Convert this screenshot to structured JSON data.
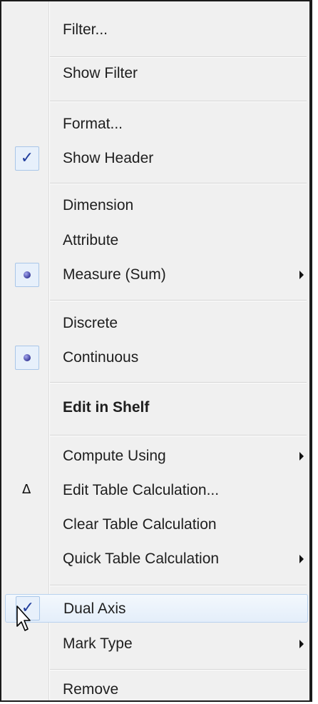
{
  "menu": {
    "items": [
      {
        "label": "Filter...",
        "icon": null
      },
      {
        "label": "Show Filter",
        "icon": null
      },
      {
        "label": "Format...",
        "icon": null
      },
      {
        "label": "Show Header",
        "icon": "checkmark-icon"
      },
      {
        "label": "Dimension",
        "icon": null
      },
      {
        "label": "Attribute",
        "icon": null
      },
      {
        "label": "Measure (Sum)",
        "icon": "radio-dot-icon",
        "submenu": true
      },
      {
        "label": "Discrete",
        "icon": null
      },
      {
        "label": "Continuous",
        "icon": "radio-dot-icon"
      },
      {
        "label": "Edit in Shelf",
        "icon": null,
        "bold": true
      },
      {
        "label": "Compute Using",
        "icon": null,
        "submenu": true
      },
      {
        "label": "Edit Table Calculation...",
        "icon": "delta-icon"
      },
      {
        "label": "Clear Table Calculation",
        "icon": null
      },
      {
        "label": "Quick Table Calculation",
        "icon": null,
        "submenu": true
      },
      {
        "label": "Dual Axis",
        "icon": "checkmark-icon",
        "hovered": true
      },
      {
        "label": "Mark Type",
        "icon": null,
        "submenu": true
      },
      {
        "label": "Remove",
        "icon": null
      }
    ]
  },
  "icons": {
    "check_glyph": "✓",
    "delta_glyph": "Δ"
  },
  "colors": {
    "menu_background": "#f0f0f0",
    "hover_highlight": "#e4eefa",
    "check_color": "#1f3c9c"
  }
}
